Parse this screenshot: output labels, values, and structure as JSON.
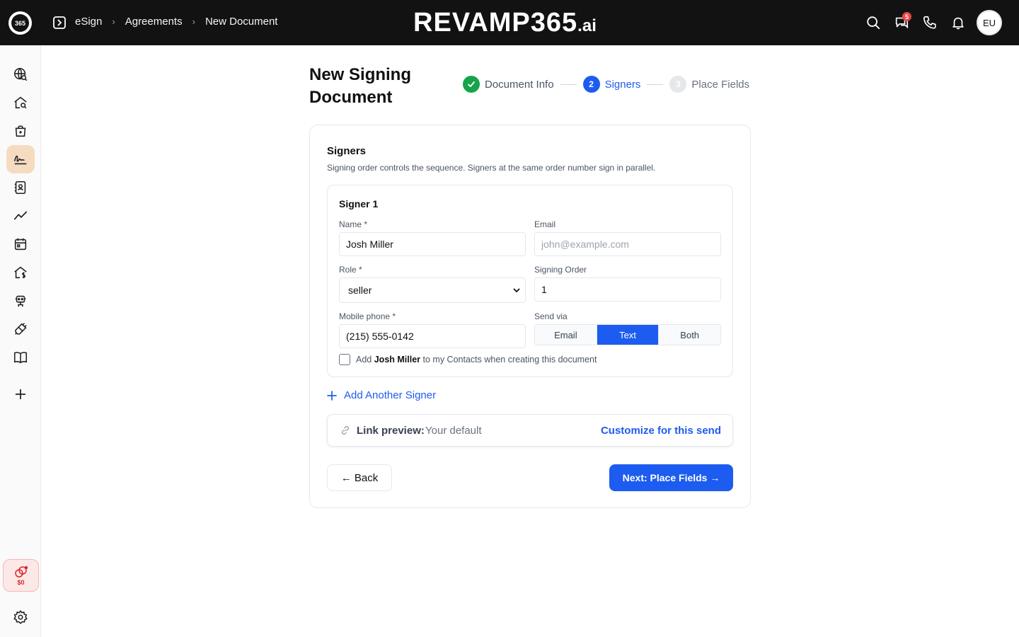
{
  "header": {
    "logo_text": "365",
    "breadcrumb": [
      "eSign",
      "Agreements",
      "New Document"
    ],
    "brand_main": "REVAMP365",
    "brand_suffix": ".ai",
    "notification_badge": "5",
    "avatar_initials": "EU"
  },
  "rail": {
    "items": [
      "globe-search-icon",
      "home-search-icon",
      "bag-icon",
      "signature-icon",
      "contacts-book-icon",
      "trend-line-icon",
      "calendar-icon",
      "home-dollar-icon",
      "robot-icon",
      "plug-icon",
      "book-icon",
      "plus-icon"
    ],
    "active": "signature-icon",
    "credit_amount": "$0"
  },
  "page": {
    "title": "New Signing Document",
    "steps": [
      {
        "number": "1",
        "label": "Document Info",
        "state": "done"
      },
      {
        "number": "2",
        "label": "Signers",
        "state": "current"
      },
      {
        "number": "3",
        "label": "Place Fields",
        "state": "todo"
      }
    ]
  },
  "signers_card": {
    "title": "Signers",
    "subtitle": "Signing order controls the sequence. Signers at the same order number sign in parallel.",
    "signer": {
      "title": "Signer 1",
      "name_label": "Name *",
      "name_value": "Josh Miller",
      "email_label": "Email",
      "email_placeholder": "john@example.com",
      "role_label": "Role *",
      "role_value": "seller",
      "order_label": "Signing Order",
      "order_value": "1",
      "phone_label": "Mobile phone *",
      "phone_value": "(215) 555-0142",
      "send_via_label": "Send via",
      "send_via_options": [
        "Email",
        "Text",
        "Both"
      ],
      "send_via_selected": "Text",
      "contact_prefix": "Add",
      "contact_name": "Josh Miller",
      "contact_suffix": "to my Contacts when creating this document",
      "contact_checked": false
    },
    "add_signer_label": "Add Another Signer",
    "link_preview": {
      "label": "Link preview:",
      "value": "Your default",
      "action": "Customize for this send"
    },
    "back_label": "← Back",
    "next_label": "Next: Place Fields →"
  },
  "colors": {
    "accent": "#1d5cf0",
    "success": "#16a34a",
    "topbar": "#121212",
    "active_rail": "#f5dcc0"
  }
}
